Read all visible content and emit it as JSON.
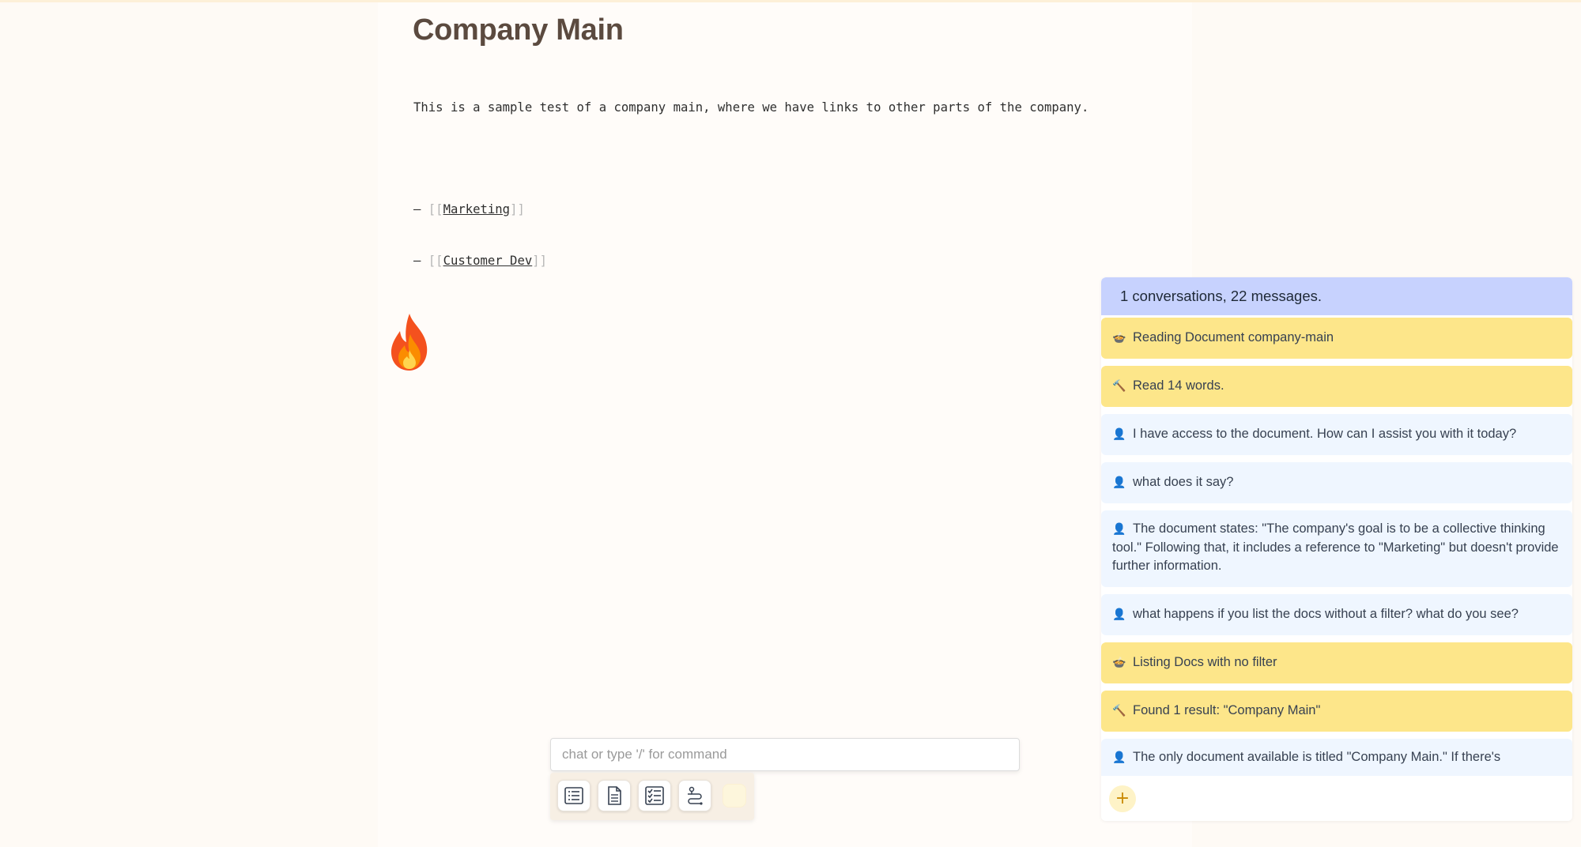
{
  "document": {
    "title": "Company Main",
    "intro": "This is a sample test of a company main, where we have links to other parts of the company.",
    "links": [
      {
        "prefix": "– ",
        "open": "[[",
        "label": "Marketing",
        "close": "]]"
      },
      {
        "prefix": "– ",
        "open": "[[",
        "label": "Customer Dev",
        "close": "]]"
      }
    ]
  },
  "mascot": {
    "icon": "flame-icon"
  },
  "composer": {
    "placeholder": "chat or type '/' for command",
    "tools": [
      "list-icon",
      "document-icon",
      "checklist-icon",
      "workflow-icon"
    ]
  },
  "chat_panel": {
    "summary": "1 conversations, 22 messages.",
    "messages": [
      {
        "kind": "tool",
        "icon": "pot-icon",
        "glyph": "🍲",
        "text": "Reading Document company-main"
      },
      {
        "kind": "tool",
        "icon": "hammer-icon",
        "glyph": "🔨",
        "text": "Read 14 words."
      },
      {
        "kind": "chat",
        "icon": "user-icon",
        "glyph": "👤",
        "text": "I have access to the document. How can I assist you with it today?"
      },
      {
        "kind": "chat",
        "icon": "user-icon",
        "glyph": "👤",
        "text": "what does it say?"
      },
      {
        "kind": "chat",
        "icon": "user-icon",
        "glyph": "👤",
        "text": "The document states: \"The company's goal is to be a collective thinking tool.\" Following that, it includes a reference to \"Marketing\" but doesn't provide further information."
      },
      {
        "kind": "chat",
        "icon": "user-icon",
        "glyph": "👤",
        "text": "what happens if you list the docs without a filter? what do you see?"
      },
      {
        "kind": "tool",
        "icon": "pot-icon",
        "glyph": "🍲",
        "text": "Listing Docs with no filter"
      },
      {
        "kind": "tool",
        "icon": "hammer-icon",
        "glyph": "🔨",
        "text": "Found 1 result: \"Company Main\""
      },
      {
        "kind": "chat",
        "icon": "user-icon",
        "glyph": "👤",
        "text": "The only document available is titled \"Company Main.\" If there's"
      }
    ],
    "add_label": "+"
  },
  "colors": {
    "page_bg": "#fefaf5",
    "header_bg": "#c7d2fe",
    "tool_msg_bg": "#fde68a",
    "chat_msg_bg": "#eff6ff",
    "title_color": "#5b4a3f"
  }
}
